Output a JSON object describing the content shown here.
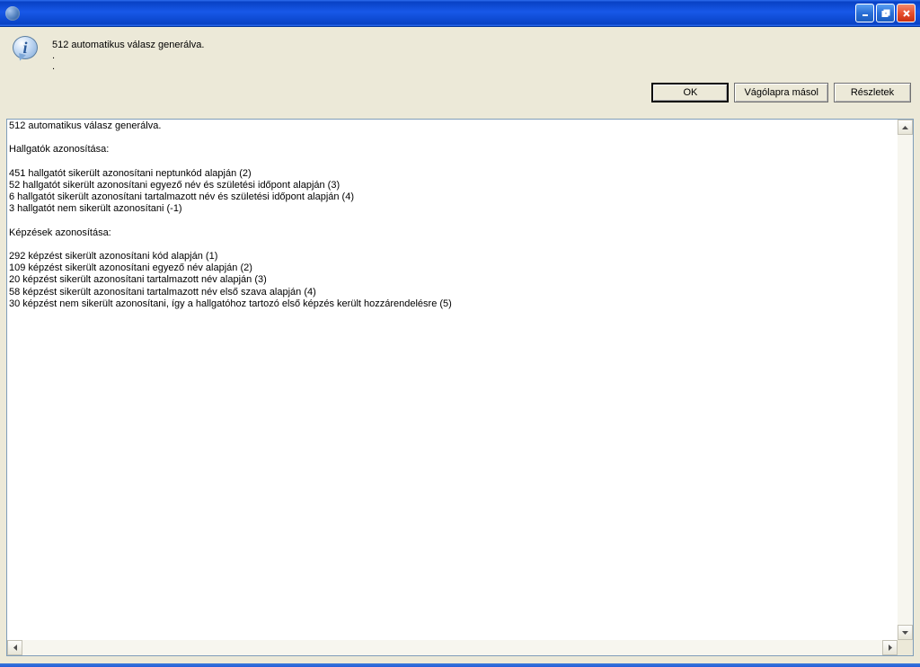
{
  "window": {
    "title": ""
  },
  "message": {
    "text": "512 automatikus válasz generálva.\n.\n."
  },
  "buttons": {
    "ok": "OK",
    "clipboard": "Vágólapra másol",
    "details": "Részletek"
  },
  "details_text": "512 automatikus válasz generálva.\n\nHallgatók azonosítása:\n\n451 hallgatót sikerült azonosítani neptunkód alapján (2)\n52 hallgatót sikerült azonosítani egyező név és születési időpont alapján (3)\n6 hallgatót sikerült azonosítani tartalmazott név és születési időpont alapján (4)\n3 hallgatót nem sikerült azonosítani (-1)\n\nKépzések azonosítása:\n\n292 képzést sikerült azonosítani kód alapján (1)\n109 képzést sikerült azonosítani egyező név alapján (2)\n20 képzést sikerült azonosítani tartalmazott név alapján (3)\n58 képzést sikerült azonosítani tartalmazott név első szava alapján (4)\n30 képzést nem sikerült azonosítani, így a hallgatóhoz tartozó első képzés került hozzárendelésre (5)"
}
